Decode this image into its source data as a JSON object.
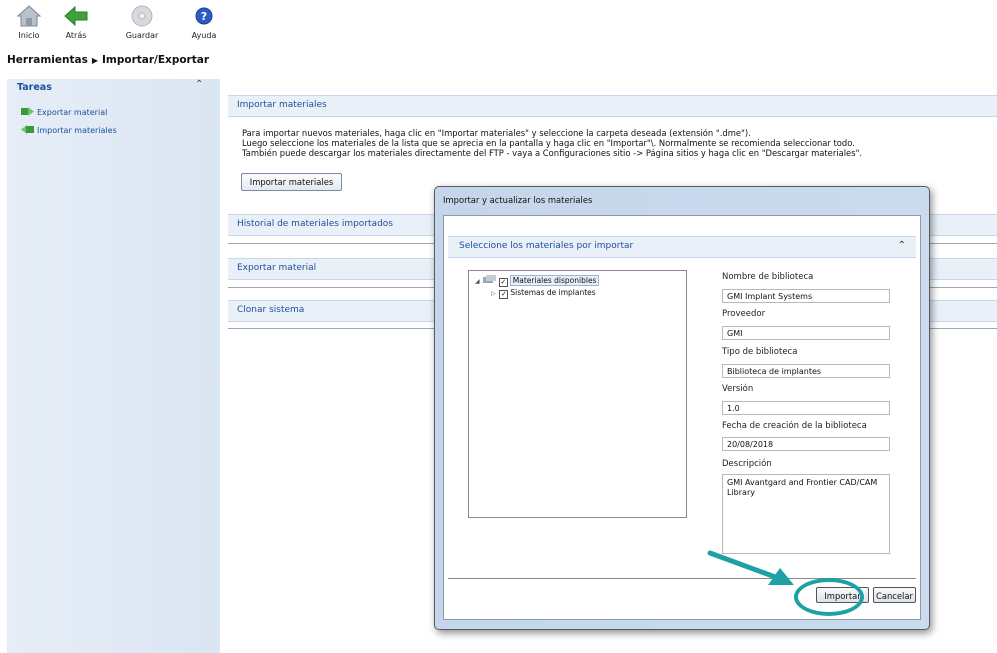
{
  "toolbar": {
    "buttons": [
      {
        "label": "Inicio",
        "icon": "home-icon"
      },
      {
        "label": "Atrás",
        "icon": "back-arrow-icon"
      },
      {
        "label": "Guardar",
        "icon": "save-disc-icon"
      },
      {
        "label": "Ayuda",
        "icon": "help-icon"
      }
    ]
  },
  "breadcrumb": {
    "root": "Herramientas",
    "current": "Importar/Exportar"
  },
  "sidebar": {
    "title": "Tareas",
    "items": [
      {
        "label": "Exportar material",
        "icon": "export-icon"
      },
      {
        "label": "Importar materiales",
        "icon": "import-icon"
      }
    ]
  },
  "main": {
    "sections": [
      {
        "title": "Importar materiales"
      },
      {
        "title": "Historial de materiales importados"
      },
      {
        "title": "Exportar material"
      },
      {
        "title": "Clonar sistema"
      }
    ],
    "intro_lines": [
      "Para importar nuevos materiales, haga clic en \"Importar materiales\" y seleccione la carpeta deseada (extensión \".dme\").",
      "Luego seleccione los materiales de la lista que se aprecia en la pantalla y haga clic en \"Importar\"\\. Normalmente se recomienda seleccionar todo.",
      "También puede descargar los materiales directamente del FTP - vaya a Configuraciones sitio -> Página sitios y haga clic en \"Descargar materiales\"."
    ],
    "import_button": "Importar materiales"
  },
  "dialog": {
    "title": "Importar y actualizar los materiales",
    "section_title": "Seleccione los materiales por importar",
    "tree": [
      {
        "label": "Materiales disponibles",
        "checked": true,
        "expanded": true
      },
      {
        "label": "Sistemas de implantes",
        "checked": true,
        "expanded": false
      }
    ],
    "fields": {
      "library_name_label": "Nombre de biblioteca",
      "library_name": "GMI Implant Systems",
      "provider_label": "Proveedor",
      "provider": "GMI",
      "library_type_label": "Tipo de biblioteca",
      "library_type": "Biblioteca de implantes",
      "version_label": "Versión",
      "version": "1.0",
      "created_label": "Fecha de creación de la biblioteca",
      "created": "20/08/2018",
      "description_label": "Descripción",
      "description": "GMI Avantgard and Frontier CAD/CAM Library"
    },
    "buttons": {
      "import": "Importar",
      "cancel": "Cancelar"
    }
  },
  "colors": {
    "accent": "#1d4f9c",
    "highlight_annotation": "#1ea1a6"
  }
}
